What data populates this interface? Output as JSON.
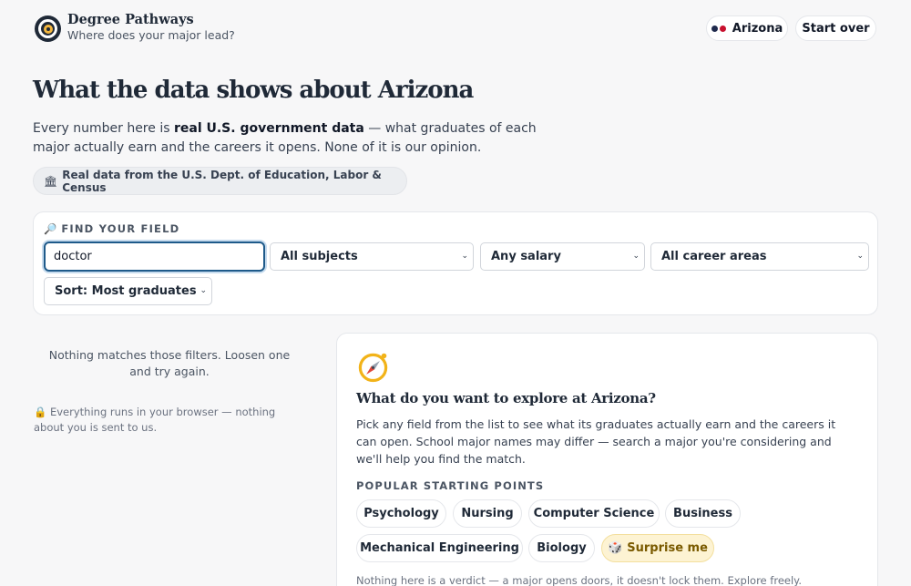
{
  "header": {
    "brand_title": "Degree Pathways",
    "brand_subtitle": "Where does your major lead?",
    "state_button": "Arizona",
    "state_dot_colors": [
      "#1f2a4d",
      "#c8102e"
    ],
    "start_over_button": "Start over"
  },
  "hero": {
    "title": "What the data shows about Arizona",
    "intro_part1": "Every number here is ",
    "intro_bold": "real U.S. government data",
    "intro_part2": " — what graduates of each major actually earn and the careers it opens. None of it is our opinion.",
    "source_icon": "🏛",
    "source_chip": "Real data from the U.S. Dept. of Education, Labor & Census"
  },
  "filters": {
    "label_icon": "🔎",
    "label": "FIND YOUR FIELD",
    "search_value": "doctor",
    "subject_select": "All subjects",
    "salary_select": "Any salary",
    "career_select": "All career areas",
    "sort_select": "Sort: Most graduates",
    "chevron": "⌄"
  },
  "results": {
    "empty_message": "Nothing matches those filters. Loosen one and try again.",
    "privacy_icon": "🔒",
    "privacy_note": "Everything runs in your browser — nothing about you is sent to us."
  },
  "explore": {
    "title": "What do you want to explore at Arizona?",
    "description": "Pick any field from the list to see what its graduates actually earn and the careers it can open. School major names may differ — search a major you're considering and we'll help you find the match.",
    "popular_label": "POPULAR STARTING POINTS",
    "chips": [
      "Psychology",
      "Nursing",
      "Computer Science",
      "Business",
      "Mechanical Engineering",
      "Biology"
    ],
    "surprise_icon": "🎲",
    "surprise_label": "Surprise me",
    "footnote": "Nothing here is a verdict — a major opens doors, it doesn't lock them. Explore freely."
  },
  "colors": {
    "accent_blue": "#1e5a8a",
    "surprise_bg": "#fdf3d3",
    "text_dark": "#1f2937"
  }
}
